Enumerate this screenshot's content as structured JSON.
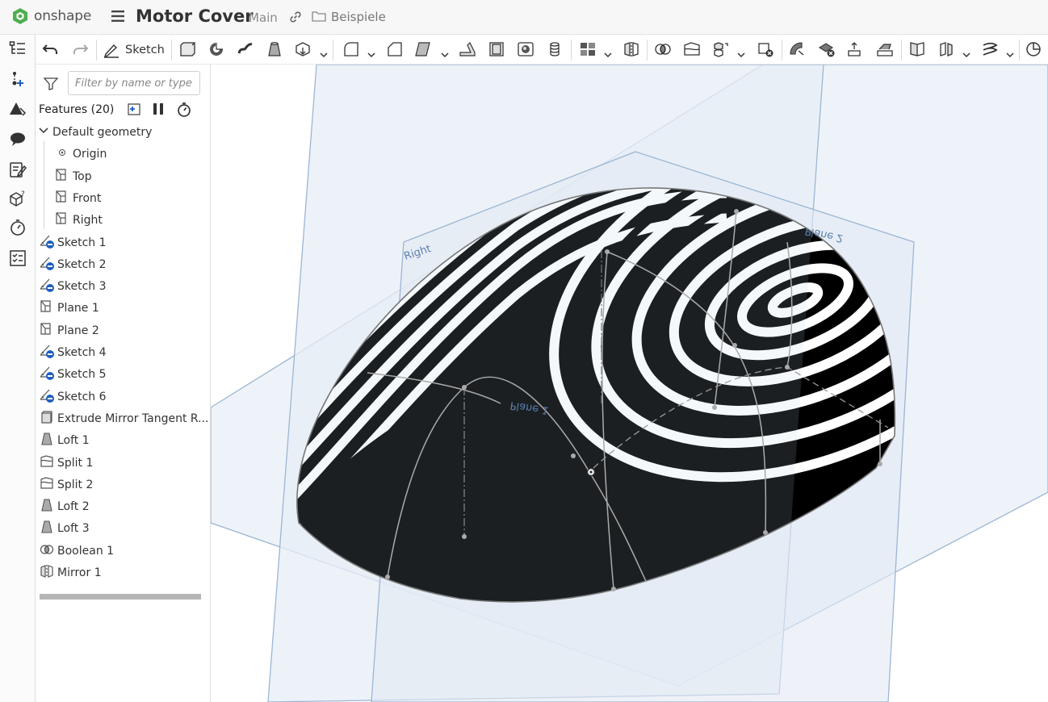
{
  "header": {
    "logo_text": "onshape",
    "document_title": "Motor Cover",
    "branch": "Main",
    "folder": "Beispiele"
  },
  "toolbar": {
    "sketch_label": "Sketch"
  },
  "panel": {
    "filter_placeholder": "Filter by name or type",
    "features_title": "Features (20)",
    "default_geometry": {
      "label": "Default geometry",
      "children": [
        "Origin",
        "Top",
        "Front",
        "Right"
      ]
    },
    "features": [
      {
        "label": "Sketch 1",
        "icon": "sketch-icon"
      },
      {
        "label": "Sketch 2",
        "icon": "sketch-icon"
      },
      {
        "label": "Sketch 3",
        "icon": "sketch-icon"
      },
      {
        "label": "Plane 1",
        "icon": "plane-icon"
      },
      {
        "label": "Plane 2",
        "icon": "plane-icon"
      },
      {
        "label": "Sketch 4",
        "icon": "sketch-icon"
      },
      {
        "label": "Sketch 5",
        "icon": "sketch-icon"
      },
      {
        "label": "Sketch 6",
        "icon": "sketch-icon"
      },
      {
        "label": "Extrude Mirror Tangent R...",
        "icon": "extrude-icon"
      },
      {
        "label": "Loft 1",
        "icon": "loft-icon"
      },
      {
        "label": "Split 1",
        "icon": "split-icon"
      },
      {
        "label": "Split 2",
        "icon": "split-icon"
      },
      {
        "label": "Loft 2",
        "icon": "loft-icon"
      },
      {
        "label": "Loft 3",
        "icon": "loft-icon"
      },
      {
        "label": "Boolean 1",
        "icon": "boolean-icon"
      },
      {
        "label": "Mirror 1",
        "icon": "mirror-icon"
      }
    ]
  },
  "viewport": {
    "plane_labels": [
      "Right",
      "Plane 1",
      "Plane 2"
    ]
  },
  "colors": {
    "brand_green": "#4fae4f",
    "plane_fill": "#e9eff6",
    "plane_edge": "#9cb6d4",
    "plane_text": "#5a7fb0",
    "sketch_badge": "#1f5fbf"
  }
}
